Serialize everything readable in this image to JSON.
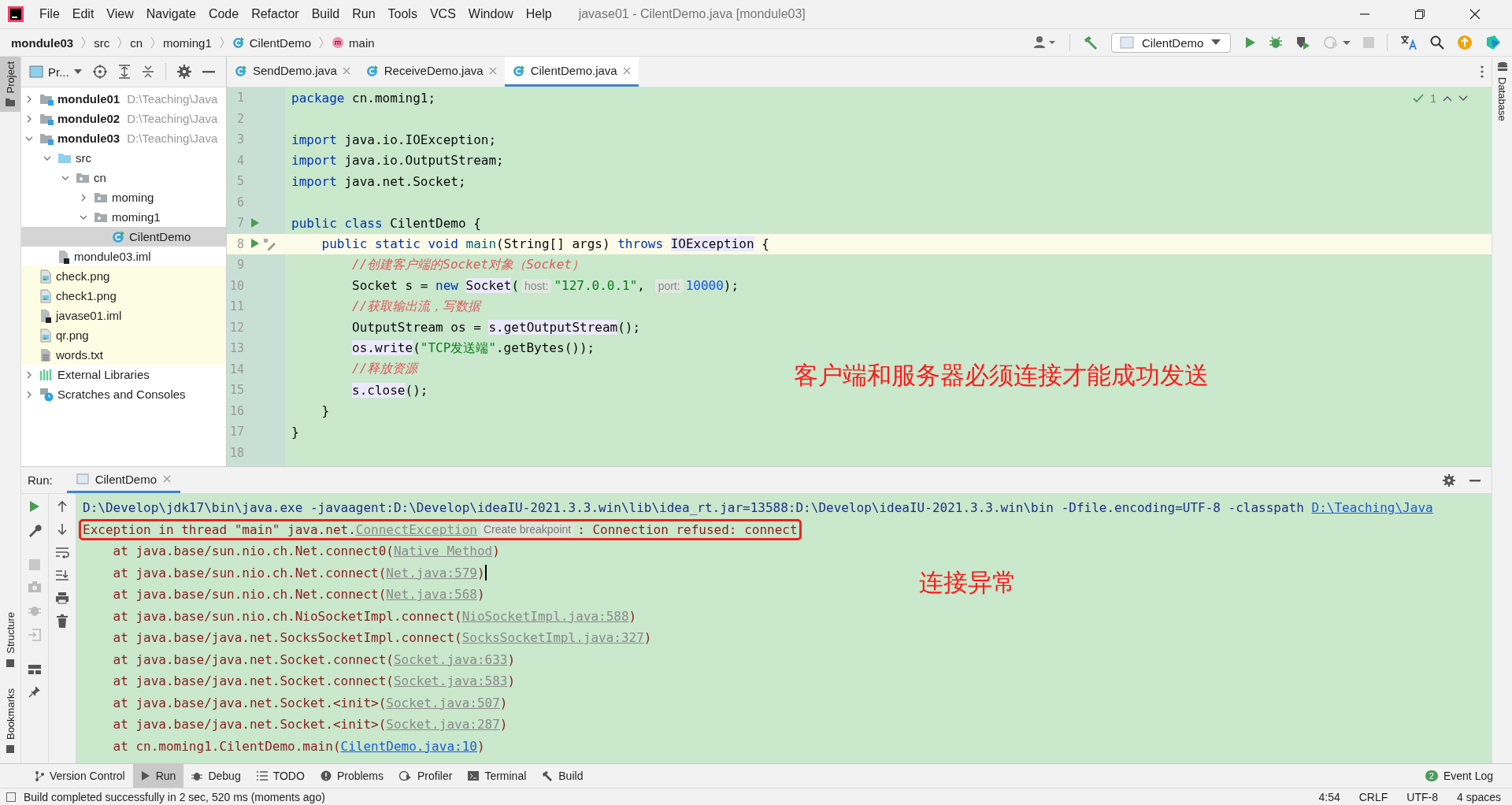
{
  "menu": [
    "File",
    "Edit",
    "View",
    "Navigate",
    "Code",
    "Refactor",
    "Build",
    "Run",
    "Tools",
    "VCS",
    "Window",
    "Help"
  ],
  "window_title": "javase01 - CilentDemo.java [mondule03]",
  "breadcrumbs": [
    {
      "label": "mondule03",
      "kind": "module"
    },
    {
      "label": "src",
      "kind": "folder"
    },
    {
      "label": "cn",
      "kind": "folder"
    },
    {
      "label": "moming1",
      "kind": "folder"
    },
    {
      "label": "CilentDemo",
      "kind": "class"
    },
    {
      "label": "main",
      "kind": "method"
    }
  ],
  "run_config": "CilentDemo",
  "left_tabs": [
    {
      "label": "Project",
      "selected": true,
      "kind": "top"
    },
    {
      "label": "Structure",
      "selected": false,
      "kind": "bottom"
    },
    {
      "label": "Bookmarks",
      "selected": false,
      "kind": "bottom"
    }
  ],
  "right_tabs": [
    {
      "label": "Database",
      "selected": false
    }
  ],
  "project": {
    "title": "Pr...",
    "tree": [
      {
        "label": "mondule01",
        "path": "D:\\Teaching\\Java",
        "kind": "module",
        "expanded": false,
        "selected": false,
        "highlighted": false
      },
      {
        "label": "mondule02",
        "path": "D:\\Teaching\\Java",
        "kind": "module",
        "expanded": false,
        "selected": false,
        "highlighted": false
      },
      {
        "label": "mondule03",
        "path": "D:\\Teaching\\Java",
        "kind": "module",
        "expanded": true,
        "selected": false,
        "highlighted": false,
        "children": [
          {
            "label": "src",
            "kind": "source",
            "expanded": true,
            "selected": false,
            "children": [
              {
                "label": "cn",
                "kind": "package",
                "expanded": true,
                "selected": false,
                "children": [
                  {
                    "label": "moming",
                    "kind": "package",
                    "expanded": false,
                    "selected": false
                  },
                  {
                    "label": "moming1",
                    "kind": "package",
                    "expanded": true,
                    "selected": false,
                    "children": [
                      {
                        "label": "CilentDemo",
                        "kind": "class",
                        "selected": true
                      }
                    ]
                  }
                ]
              }
            ]
          },
          {
            "label": "mondule03.iml",
            "kind": "iml",
            "selected": false
          }
        ]
      },
      {
        "label": "check.png",
        "kind": "image",
        "selected": false,
        "highlighted": true
      },
      {
        "label": "check1.png",
        "kind": "image",
        "selected": false,
        "highlighted": true
      },
      {
        "label": "javase01.iml",
        "kind": "iml",
        "selected": false,
        "highlighted": true
      },
      {
        "label": "qr.png",
        "kind": "image",
        "selected": false,
        "highlighted": true
      },
      {
        "label": "words.txt",
        "kind": "text",
        "selected": false,
        "highlighted": true
      },
      {
        "label": "External Libraries",
        "kind": "libraries",
        "expanded": false,
        "selected": false,
        "highlighted": false
      },
      {
        "label": "Scratches and Consoles",
        "kind": "scratches",
        "expanded": false,
        "selected": false,
        "highlighted": false
      }
    ]
  },
  "editor_tabs": [
    {
      "label": "SendDemo.java",
      "selected": false
    },
    {
      "label": "ReceiveDemo.java",
      "selected": false
    },
    {
      "label": "CilentDemo.java",
      "selected": true
    }
  ],
  "inspection_count": "1",
  "code_lines": [
    {
      "number": "1",
      "tokens": [
        {
          "kind": "kw",
          "text": "package"
        },
        {
          "kind": "plain",
          "text": " cn.moming1;"
        }
      ]
    },
    {
      "number": "2"
    },
    {
      "number": "3",
      "tokens": [
        {
          "kind": "kw",
          "text": "import"
        },
        {
          "kind": "plain",
          "text": " java.io.IOException;"
        }
      ]
    },
    {
      "number": "4",
      "tokens": [
        {
          "kind": "kw",
          "text": "import"
        },
        {
          "kind": "plain",
          "text": " java.io.OutputStream;"
        }
      ]
    },
    {
      "number": "5",
      "tokens": [
        {
          "kind": "kw",
          "text": "import"
        },
        {
          "kind": "plain",
          "text": " java.net.Socket;"
        }
      ]
    },
    {
      "number": "6"
    },
    {
      "number": "7",
      "run": true,
      "tokens": [
        {
          "kind": "kw",
          "text": "public class"
        },
        {
          "kind": "plain",
          "text": " CilentDemo {"
        }
      ]
    },
    {
      "number": "8",
      "run": true,
      "current": true,
      "tokens": [
        {
          "kind": "kw",
          "text": "    public static void"
        },
        {
          "kind": "decl",
          "text": " main"
        },
        {
          "kind": "plain",
          "text": "(String[] args) "
        },
        {
          "kind": "kw",
          "text": "throws"
        },
        {
          "kind": "hl",
          "text": " IOException"
        },
        {
          "kind": "plain",
          "text": " {"
        }
      ]
    },
    {
      "number": "9",
      "tokens": [
        {
          "kind": "cmt",
          "text": "        //创建客户端的Socket对象（Socket）"
        }
      ]
    },
    {
      "number": "10",
      "tokens": [
        {
          "kind": "plain",
          "text": "        Socket s = "
        },
        {
          "kind": "kw",
          "text": "new"
        },
        {
          "kind": "hl",
          "text": " Socket"
        },
        {
          "kind": "plain",
          "text": "("
        },
        {
          "kind": "hint",
          "text": "host:"
        },
        {
          "kind": "str",
          "text": "\"127.0.0.1\""
        },
        {
          "kind": "plain",
          "text": ", "
        },
        {
          "kind": "hint",
          "text": "port:"
        },
        {
          "kind": "num",
          "text": "10000"
        },
        {
          "kind": "plain",
          "text": ");"
        }
      ]
    },
    {
      "number": "11",
      "tokens": [
        {
          "kind": "cmt",
          "text": "        //获取输出流，写数据"
        }
      ]
    },
    {
      "number": "12",
      "tokens": [
        {
          "kind": "plain",
          "text": "        OutputStream os = "
        },
        {
          "kind": "hl",
          "text": "s.getOutputStream"
        },
        {
          "kind": "plain",
          "text": "();"
        }
      ]
    },
    {
      "number": "13",
      "tokens": [
        {
          "kind": "hl",
          "text": "        os.write"
        },
        {
          "kind": "plain",
          "text": "("
        },
        {
          "kind": "str",
          "text": "\"TCP发送端\""
        },
        {
          "kind": "plain",
          "text": ".getBytes());"
        }
      ]
    },
    {
      "number": "14",
      "tokens": [
        {
          "kind": "cmt",
          "text": "        //释放资源"
        }
      ]
    },
    {
      "number": "15",
      "tokens": [
        {
          "kind": "hl",
          "text": "        s.close"
        },
        {
          "kind": "plain",
          "text": "();"
        }
      ]
    },
    {
      "number": "16",
      "tokens": [
        {
          "kind": "plain",
          "text": "    }"
        }
      ]
    },
    {
      "number": "17",
      "tokens": [
        {
          "kind": "plain",
          "text": "}"
        }
      ]
    },
    {
      "number": "18"
    }
  ],
  "editor_annotation": "客户端和服务器必须连接才能成功发送",
  "run_panel": {
    "label": "Run:",
    "tab": "CilentDemo",
    "lines": [
      {
        "kind": "command",
        "segments": [
          {
            "kind": "text",
            "text": "D:\\Develop\\jdk17\\bin\\java.exe -javaagent:D:\\Develop\\ideaIU-2021.3.3.win\\lib\\idea_rt.jar=13588:D:\\Develop\\ideaIU-2021.3.3.win\\bin -Dfile.encoding=UTF-8 -classpath "
          },
          {
            "kind": "source_link",
            "text": "D:\\Teaching\\Java"
          }
        ]
      },
      {
        "kind": "error",
        "framed": true,
        "segments": [
          {
            "kind": "text",
            "text": "Exception in thread \"main\" java.net."
          },
          {
            "kind": "link",
            "text": "ConnectException"
          },
          {
            "kind": "inlay",
            "text": "Create breakpoint"
          },
          {
            "kind": "text",
            "text": ": Connection refused: connect"
          }
        ]
      },
      {
        "kind": "error",
        "framed": false,
        "segments": [
          {
            "kind": "text",
            "text": "    at java.base/sun.nio.ch.Net.connect0("
          },
          {
            "kind": "link",
            "text": "Native Method"
          },
          {
            "kind": "text",
            "text": ")"
          }
        ]
      },
      {
        "kind": "error",
        "framed": false,
        "caret": true,
        "segments": [
          {
            "kind": "text",
            "text": "    at java.base/sun.nio.ch.Net.connect("
          },
          {
            "kind": "link",
            "text": "Net.java:579"
          },
          {
            "kind": "text",
            "text": ")"
          }
        ]
      },
      {
        "kind": "error",
        "framed": false,
        "segments": [
          {
            "kind": "text",
            "text": "    at java.base/sun.nio.ch.Net.connect("
          },
          {
            "kind": "link",
            "text": "Net.java:568"
          },
          {
            "kind": "text",
            "text": ")"
          }
        ]
      },
      {
        "kind": "error",
        "framed": false,
        "segments": [
          {
            "kind": "text",
            "text": "    at java.base/sun.nio.ch.NioSocketImpl.connect("
          },
          {
            "kind": "link",
            "text": "NioSocketImpl.java:588"
          },
          {
            "kind": "text",
            "text": ")"
          }
        ]
      },
      {
        "kind": "error",
        "framed": false,
        "segments": [
          {
            "kind": "text",
            "text": "    at java.base/java.net.SocksSocketImpl.connect("
          },
          {
            "kind": "link",
            "text": "SocksSocketImpl.java:327"
          },
          {
            "kind": "text",
            "text": ")"
          }
        ]
      },
      {
        "kind": "error",
        "framed": false,
        "segments": [
          {
            "kind": "text",
            "text": "    at java.base/java.net.Socket.connect("
          },
          {
            "kind": "link",
            "text": "Socket.java:633"
          },
          {
            "kind": "text",
            "text": ")"
          }
        ]
      },
      {
        "kind": "error",
        "framed": false,
        "segments": [
          {
            "kind": "text",
            "text": "    at java.base/java.net.Socket.connect("
          },
          {
            "kind": "link",
            "text": "Socket.java:583"
          },
          {
            "kind": "text",
            "text": ")"
          }
        ]
      },
      {
        "kind": "error",
        "framed": false,
        "segments": [
          {
            "kind": "text",
            "text": "    at java.base/java.net.Socket.<init>("
          },
          {
            "kind": "link",
            "text": "Socket.java:507"
          },
          {
            "kind": "text",
            "text": ")"
          }
        ]
      },
      {
        "kind": "error",
        "framed": false,
        "segments": [
          {
            "kind": "text",
            "text": "    at java.base/java.net.Socket.<init>("
          },
          {
            "kind": "link",
            "text": "Socket.java:287"
          },
          {
            "kind": "text",
            "text": ")"
          }
        ]
      },
      {
        "kind": "error",
        "framed": false,
        "segments": [
          {
            "kind": "text",
            "text": "    at cn.moming1.CilentDemo.main("
          },
          {
            "kind": "source_link",
            "text": "CilentDemo.java:10"
          },
          {
            "kind": "text",
            "text": ")"
          }
        ]
      }
    ],
    "annotation": "连接异常"
  },
  "tool_windows": [
    {
      "label": "Version Control",
      "kind": "vcs",
      "selected": false
    },
    {
      "label": "Run",
      "kind": "run",
      "selected": true
    },
    {
      "label": "Debug",
      "kind": "debug",
      "selected": false
    },
    {
      "label": "TODO",
      "kind": "todo",
      "selected": false
    },
    {
      "label": "Problems",
      "kind": "problems",
      "selected": false
    },
    {
      "label": "Profiler",
      "kind": "profiler",
      "selected": false
    },
    {
      "label": "Terminal",
      "kind": "terminal",
      "selected": false
    },
    {
      "label": "Build",
      "kind": "build",
      "selected": false
    }
  ],
  "event_log": {
    "label": "Event Log",
    "count": "2"
  },
  "status": {
    "message": "Build completed successfully in 2 sec, 520 ms (moments ago)",
    "items": [
      "4:54",
      "CRLF",
      "UTF-8",
      "4 spaces"
    ]
  }
}
